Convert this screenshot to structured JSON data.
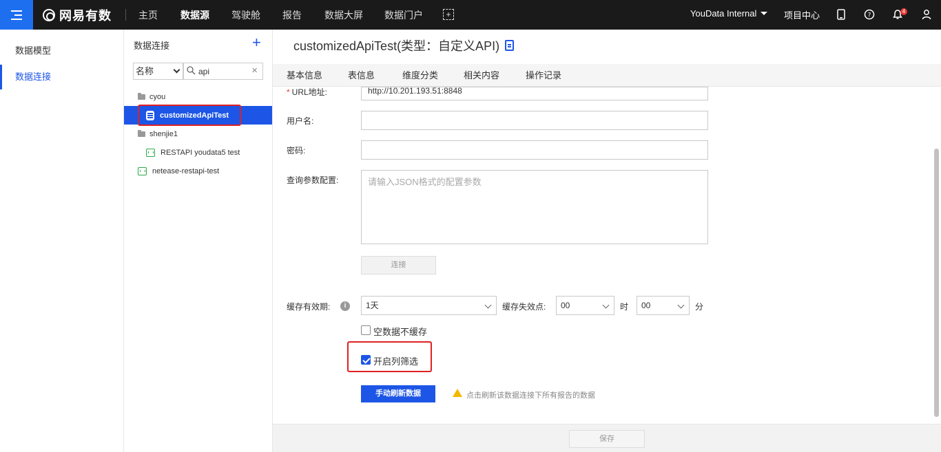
{
  "topnav": {
    "logo_text": "网易有数",
    "items": [
      {
        "label": "主页",
        "active": false
      },
      {
        "label": "数据源",
        "active": true
      },
      {
        "label": "驾驶舱",
        "active": false
      },
      {
        "label": "报告",
        "active": false
      },
      {
        "label": "数据大屏",
        "active": false
      },
      {
        "label": "数据门户",
        "active": false
      }
    ],
    "user": "YouData Internal",
    "project_center": "项目中心",
    "notification_count": "4"
  },
  "sidebar": {
    "items": [
      {
        "label": "数据模型",
        "active": false
      },
      {
        "label": "数据连接",
        "active": true
      }
    ]
  },
  "tree": {
    "title": "数据连接",
    "filter_field": "名称",
    "search_value": "api",
    "nodes": [
      {
        "label": "cyou",
        "type": "folder"
      },
      {
        "label": "customizedApiTest",
        "type": "connection-selected"
      },
      {
        "label": "shenjie1",
        "type": "folder"
      },
      {
        "label": "RESTAPI youdata5 test",
        "type": "api"
      },
      {
        "label": "netease-restapi-test",
        "type": "api"
      }
    ]
  },
  "main": {
    "title": "customizedApiTest(类型：自定义API)",
    "tabs": [
      "基本信息",
      "表信息",
      "维度分类",
      "相关内容",
      "操作记录"
    ],
    "form": {
      "url_label": "URL地址:",
      "url_value": "http://10.201.193.51:8848",
      "username_label": "用户名:",
      "username_value": "",
      "password_label": "密码:",
      "password_value": "",
      "query_label": "查询参数配置:",
      "query_placeholder": "请输入JSON格式的配置参数",
      "connect_label": "连接",
      "cache_label": "缓存有效期:",
      "cache_value": "1天",
      "expire_label": "缓存失效点:",
      "hour_value": "00",
      "hour_unit": "时",
      "minute_value": "00",
      "minute_unit": "分",
      "empty_no_cache_label": "空数据不缓存",
      "empty_no_cache_checked": false,
      "column_filter_label": "开启列筛选",
      "column_filter_checked": true,
      "refresh_label": "手动刷新数据",
      "refresh_hint": "点击刷新该数据连接下所有报告的数据"
    },
    "save_label": "保存"
  },
  "colors": {
    "accent": "#1d56e6",
    "topbar": "#1a1a1a",
    "highlight": "#e02020"
  }
}
